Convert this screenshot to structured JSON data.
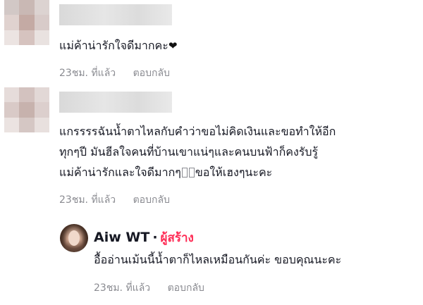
{
  "comments": [
    {
      "text_lines": [
        "แม่ค้าน่ารักใจดีมากคะ"
      ],
      "heart_icon": "heart-icon",
      "time": "23ชม. ที่แล้ว",
      "reply_label": "ตอบกลับ"
    },
    {
      "text_lines": [
        "แกรรรรฉันน้ำตาไหลกับคำว่าขอไม่คิดเงินและขอทำให้อีก",
        "ทุกๆปี มันฮีลใจคนที่บ้านเขาแน่ๆและคนบนฟ้าก็คงรับรู้",
        "แม่ค้าน่ารักและใจดีมากๆ",
        "ขอให้เฮงๆนะคะ"
      ],
      "time": "23ชม. ที่แล้ว",
      "reply_label": "ตอบกลับ"
    }
  ],
  "reply": {
    "author": "Aiw WT",
    "separator": "·",
    "badge": "ผู้สร้าง",
    "text": "อื้ออ่านเม้นนี้น้ำตาก็ไหลเหมือนกันค่ะ ขอบคุณนะคะ",
    "time": "23ชม. ที่แล้ว",
    "reply_label": "ตอบกลับ"
  },
  "colors": {
    "creator_badge": "#fe2c55",
    "meta": "#8a8b91",
    "text": "#161823"
  }
}
